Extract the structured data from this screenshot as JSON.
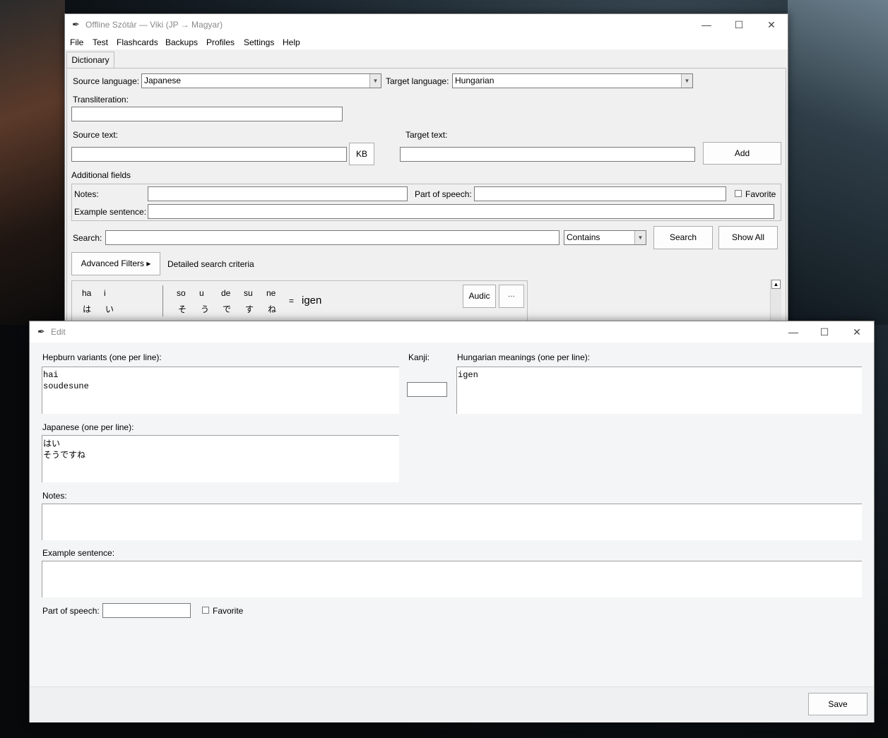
{
  "main_window": {
    "title": "Offline Szótár — Viki (JP → Magyar)",
    "menu": [
      "File",
      "Test",
      "Flashcards",
      "Backups",
      "Profiles",
      "Settings",
      "Help"
    ],
    "tab": "Dictionary",
    "source_language_label": "Source language:",
    "source_language_value": "Japanese",
    "target_language_label": "Target language:",
    "target_language_value": "Hungarian",
    "transliteration_label": "Transliteration:",
    "source_text_label": "Source text:",
    "kb_button": "KB",
    "target_text_label": "Target text:",
    "add_button": "Add",
    "additional_fields_label": "Additional fields",
    "notes_label": "Notes:",
    "part_of_speech_label": "Part of speech:",
    "favorite_label": "Favorite",
    "example_sentence_label": "Example sentence:",
    "search_label": "Search:",
    "search_mode": "Contains",
    "search_button": "Search",
    "show_all_button": "Show All",
    "advanced_filters_button": "Advanced Filters ▸",
    "detailed_criteria_label": "Detailed search criteria",
    "result": {
      "group1": [
        {
          "romaji": "ha",
          "kana": "は"
        },
        {
          "romaji": "i",
          "kana": "い"
        }
      ],
      "group2": [
        {
          "romaji": "so",
          "kana": "そ"
        },
        {
          "romaji": "u",
          "kana": "う"
        },
        {
          "romaji": "de",
          "kana": "で"
        },
        {
          "romaji": "su",
          "kana": "す"
        },
        {
          "romaji": "ne",
          "kana": "ね"
        }
      ],
      "equals": "=",
      "meaning": "igen",
      "audio_button": "Audic",
      "more_button": "···"
    }
  },
  "edit_window": {
    "title": "Edit",
    "hepburn_label": "Hepburn variants (one per line):",
    "hepburn_value": "hai\nsoudesune",
    "kanji_label": "Kanji:",
    "hungarian_label": "Hungarian meanings (one per line):",
    "hungarian_value": "igen",
    "japanese_label": "Japanese (one per line):",
    "japanese_value": "はい\nそうですね",
    "notes_label": "Notes:",
    "example_sentence_label": "Example sentence:",
    "part_of_speech_label": "Part of speech:",
    "favorite_label": "Favorite",
    "save_button": "Save"
  },
  "icons": {
    "app": "feather-icon",
    "minimize": "minimize-icon",
    "maximize": "maximize-icon",
    "close": "close-icon"
  }
}
